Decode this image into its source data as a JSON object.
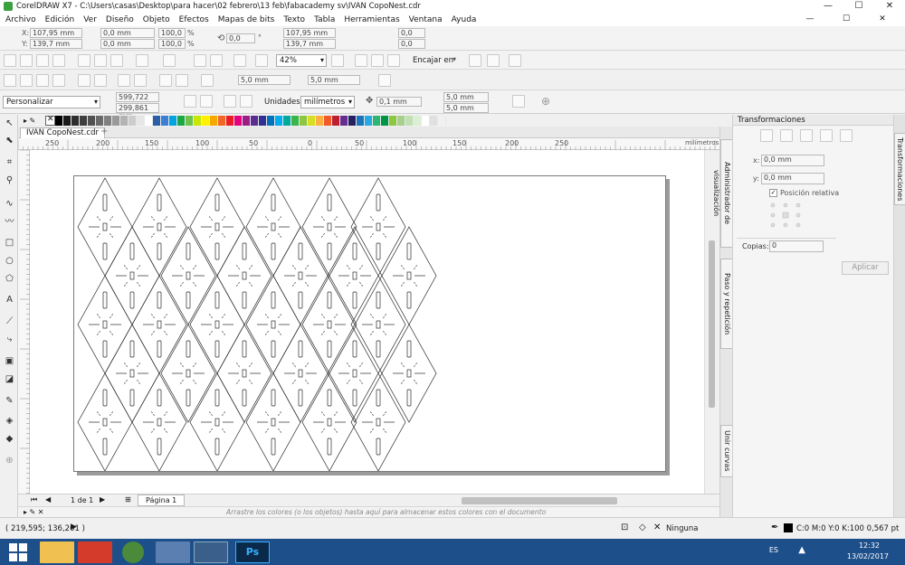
{
  "window": {
    "title": "CorelDRAW X7 - C:\\Users\\casas\\Desktop\\para hacer\\02 febrero\\13 feb\\fabacademy sv\\IVAN CopoNest.cdr",
    "controls": [
      "—",
      "☐",
      "✕"
    ]
  },
  "menu": [
    "Archivo",
    "Edición",
    "Ver",
    "Diseño",
    "Objeto",
    "Efectos",
    "Mapas de bits",
    "Texto",
    "Tabla",
    "Herramientas",
    "Ventana",
    "Ayuda"
  ],
  "property_bar": {
    "x_label": "X:",
    "x_value": "107,95 mm",
    "y_label": "Y:",
    "y_value": "139,7 mm",
    "w_value": "0,0 mm",
    "h_value": "0,0 mm",
    "sx_value": "100,0",
    "sy_value": "100,0",
    "percent": "%",
    "angle_value": "0,0",
    "degree": "°",
    "x2_value": "107,95 mm",
    "y2_value": "139,7 mm",
    "misc_value1": "0,0",
    "misc_value2": "0,0"
  },
  "standard_toolbar": {
    "zoom": "42%",
    "snap_label": "Encajar en"
  },
  "toolbar2": {
    "nudge_x": "5,0 mm",
    "nudge_y": "5,0 mm"
  },
  "document_bar": {
    "preset": "Personalizar",
    "page_w": "599,722 mm",
    "page_h": "299,861 mm",
    "units_label": "Unidades:",
    "units_value": "milímetros",
    "nudge": "0,1 mm",
    "dup_x": "5,0 mm",
    "dup_y": "5,0 mm"
  },
  "palette_colors": [
    "#000000",
    "#1a1a1a",
    "#2e2e2e",
    "#3f3f3f",
    "#525252",
    "#6b6b6b",
    "#808080",
    "#999999",
    "#b3b3b3",
    "#cccccc",
    "#e6e6e6",
    "#ffffff",
    "#2b5fa8",
    "#3a7fd5",
    "#00a3e0",
    "#1ba842",
    "#6cc24a",
    "#c8e600",
    "#fff200",
    "#f7a800",
    "#f26522",
    "#ed1c24",
    "#e5007e",
    "#9b1e87",
    "#5c2d91",
    "#2e3192",
    "#0072bc",
    "#00aeef",
    "#00a99d",
    "#39b54a",
    "#8dc63f",
    "#d7df23",
    "#fbb040",
    "#f15a29",
    "#be1e2d",
    "#662d91",
    "#262262",
    "#1b75bc",
    "#27aae1",
    "#2bb673",
    "#009444",
    "#8dc63f",
    "#a7d08c",
    "#c2e0b4",
    "#dcefd5",
    "#ffffff",
    "#e0e0e0",
    "#f0f0f0"
  ],
  "document": {
    "tab": "IVAN CopoNest.cdr",
    "ruler_unit": "milímetros",
    "ruler_ticks": [
      "250",
      "200",
      "150",
      "100",
      "50",
      "0",
      "50",
      "100",
      "150",
      "200",
      "250"
    ]
  },
  "page_nav": {
    "counter": "1 de 1",
    "page_tab": "Página 1"
  },
  "color_hint": "Arrastre los colores (o los objetos) hasta aquí para almacenar estos colores con el documento",
  "side_tabs": {
    "view_manager": "Administrador de visualización",
    "step_repeat": "Paso y repetición",
    "join_curves": "Unir curvas",
    "transformations": "Transformaciones"
  },
  "docker": {
    "title": "Transformaciones",
    "x_label": "x:",
    "x_value": "0,0 mm",
    "y_label": "y:",
    "y_value": "0,0 mm",
    "relative_label": "Posición relativa",
    "copies_label": "Copias:",
    "copies_value": "0",
    "apply_label": "Aplicar"
  },
  "status": {
    "coords": "( 219,595; 136,201 )",
    "fill_label": "Ninguna",
    "outline_label": "C:0 M:0 Y:0 K:100  0,567 pt"
  },
  "taskbar": {
    "lang": "ES",
    "time": "12:32",
    "date": "13/02/2017"
  }
}
